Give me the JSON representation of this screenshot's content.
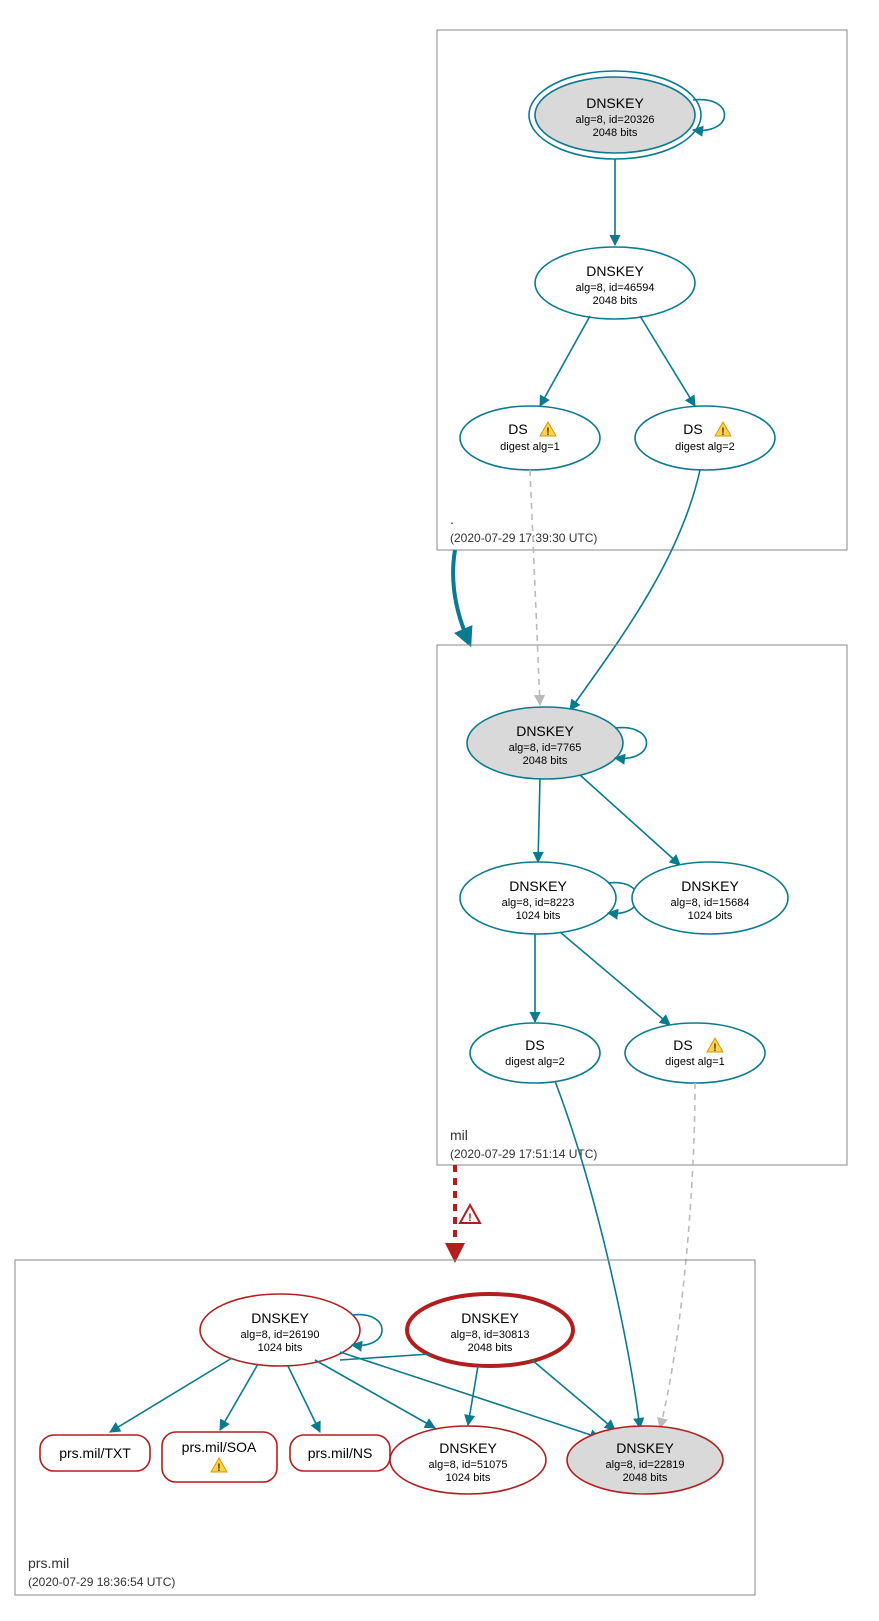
{
  "zones": {
    "root": {
      "label": ".",
      "timestamp": "(2020-07-29 17:39:30 UTC)"
    },
    "mil": {
      "label": "mil",
      "timestamp": "(2020-07-29 17:51:14 UTC)"
    },
    "prsmil": {
      "label": "prs.mil",
      "timestamp": "(2020-07-29 18:36:54 UTC)"
    }
  },
  "nodes": {
    "root_ksk": {
      "title": "DNSKEY",
      "line2": "alg=8, id=20326",
      "line3": "2048 bits"
    },
    "root_zsk": {
      "title": "DNSKEY",
      "line2": "alg=8, id=46594",
      "line3": "2048 bits"
    },
    "root_ds1": {
      "title": "DS",
      "line2": "digest alg=1"
    },
    "root_ds2": {
      "title": "DS",
      "line2": "digest alg=2"
    },
    "mil_ksk": {
      "title": "DNSKEY",
      "line2": "alg=8, id=7765",
      "line3": "2048 bits"
    },
    "mil_zsk1": {
      "title": "DNSKEY",
      "line2": "alg=8, id=8223",
      "line3": "1024 bits"
    },
    "mil_zsk2": {
      "title": "DNSKEY",
      "line2": "alg=8, id=15684",
      "line3": "1024 bits"
    },
    "mil_ds2": {
      "title": "DS",
      "line2": "digest alg=2"
    },
    "mil_ds1": {
      "title": "DS",
      "line2": "digest alg=1"
    },
    "prs_k1": {
      "title": "DNSKEY",
      "line2": "alg=8, id=26190",
      "line3": "1024 bits"
    },
    "prs_k2": {
      "title": "DNSKEY",
      "line2": "alg=8, id=30813",
      "line3": "2048 bits"
    },
    "prs_txt": {
      "title": "prs.mil/TXT"
    },
    "prs_soa": {
      "title": "prs.mil/SOA"
    },
    "prs_ns": {
      "title": "prs.mil/NS"
    },
    "prs_k3": {
      "title": "DNSKEY",
      "line2": "alg=8, id=51075",
      "line3": "1024 bits"
    },
    "prs_k4": {
      "title": "DNSKEY",
      "line2": "alg=8, id=22819",
      "line3": "2048 bits"
    }
  }
}
